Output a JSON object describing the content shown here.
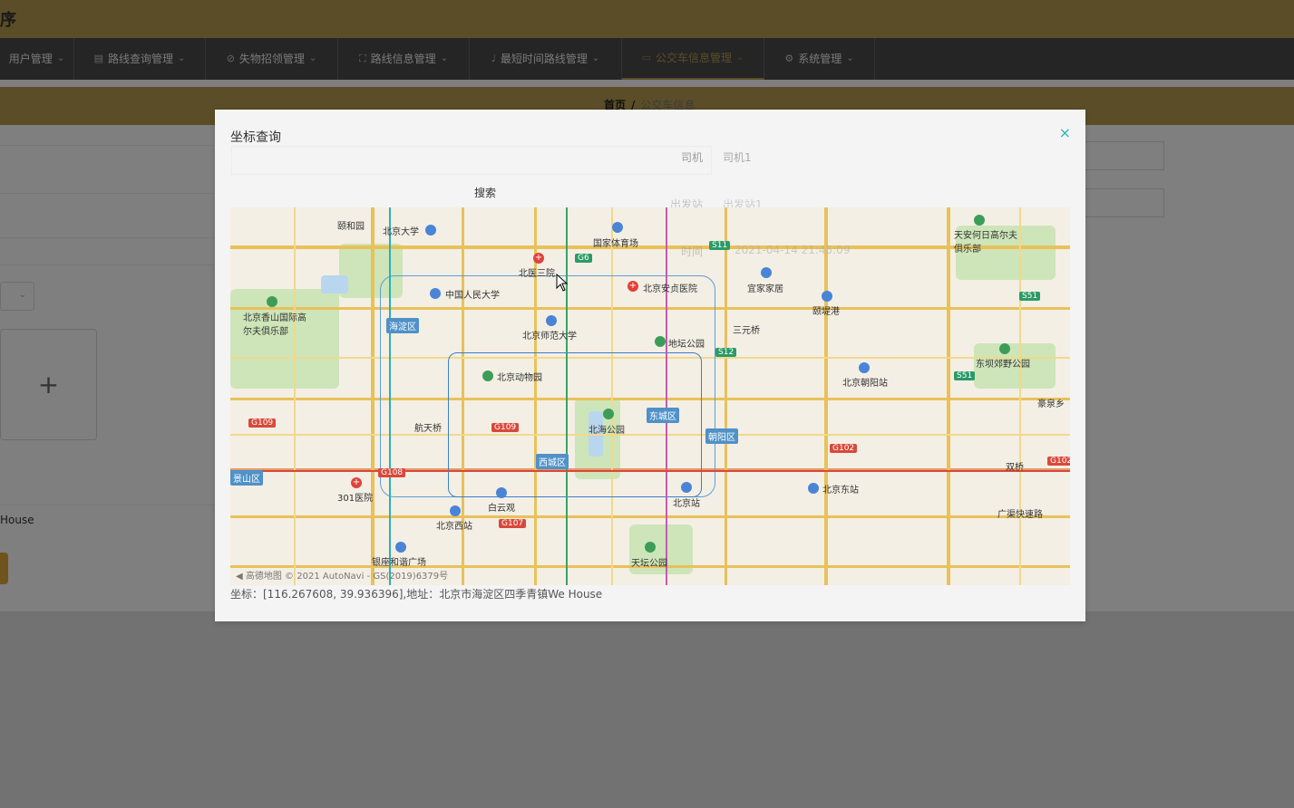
{
  "app": {
    "title": "序"
  },
  "nav": {
    "items": [
      {
        "label": "用户管理",
        "icon": "user-icon"
      },
      {
        "label": "路线查询管理",
        "icon": "clipboard-icon"
      },
      {
        "label": "失物招领管理",
        "icon": "bell-off-icon"
      },
      {
        "label": "路线信息管理",
        "icon": "frame-icon"
      },
      {
        "label": "最短时间路线管理",
        "icon": "microphone-icon"
      },
      {
        "label": "公交车信息管理",
        "icon": "bus-icon",
        "active": true
      },
      {
        "label": "系统管理",
        "icon": "gear-icon"
      }
    ]
  },
  "breadcrumb": {
    "home": "首页",
    "separator": "/",
    "current": "公交车信息"
  },
  "under": {
    "address_tail": "House",
    "upload_plus": "+"
  },
  "modal": {
    "title": "坐标查询",
    "close": "×",
    "search_label": "搜索",
    "fields": {
      "driver_label": "司机",
      "driver_value": "司机1",
      "start_label": "出发站",
      "start_value": "出发站1",
      "time_label": "时间",
      "time_value": "2021-04-14 21:45:09"
    },
    "coord_result": "坐标：[116.267608, 39.936396],地址：北京市海淀区四季青镇We House"
  },
  "map": {
    "copyright": "高德地图 © 2021 AutoNavi - GS(2019)6379号",
    "labels": [
      "颐和园",
      "北京大学",
      "国家体育场",
      "天安何日高尔夫俱乐部",
      "中国人民大学",
      "北医三院",
      "北京安贞医院",
      "宜家家居",
      "北京香山国际高尔夫俱乐部",
      "北京师范大学",
      "地坛公园",
      "颐堤港",
      "三元桥",
      "北京动物园",
      "北京朝阳站",
      "东坝郊野公园",
      "航天桥",
      "北海公园",
      "东城区",
      "朝阳区",
      "西城区",
      "301医院",
      "白云观",
      "北京站",
      "北京东站",
      "北京西站",
      "银座和谐广场",
      "天坛公园",
      "海淀区",
      "景山区",
      "双桥",
      "广渠快速路",
      "豪泉乡"
    ],
    "badges": {
      "haidian": "海淀区",
      "dongcheng": "东城区",
      "xicheng": "西城区",
      "chaoyang": "朝阳区",
      "shijingshan": "景山区"
    }
  }
}
